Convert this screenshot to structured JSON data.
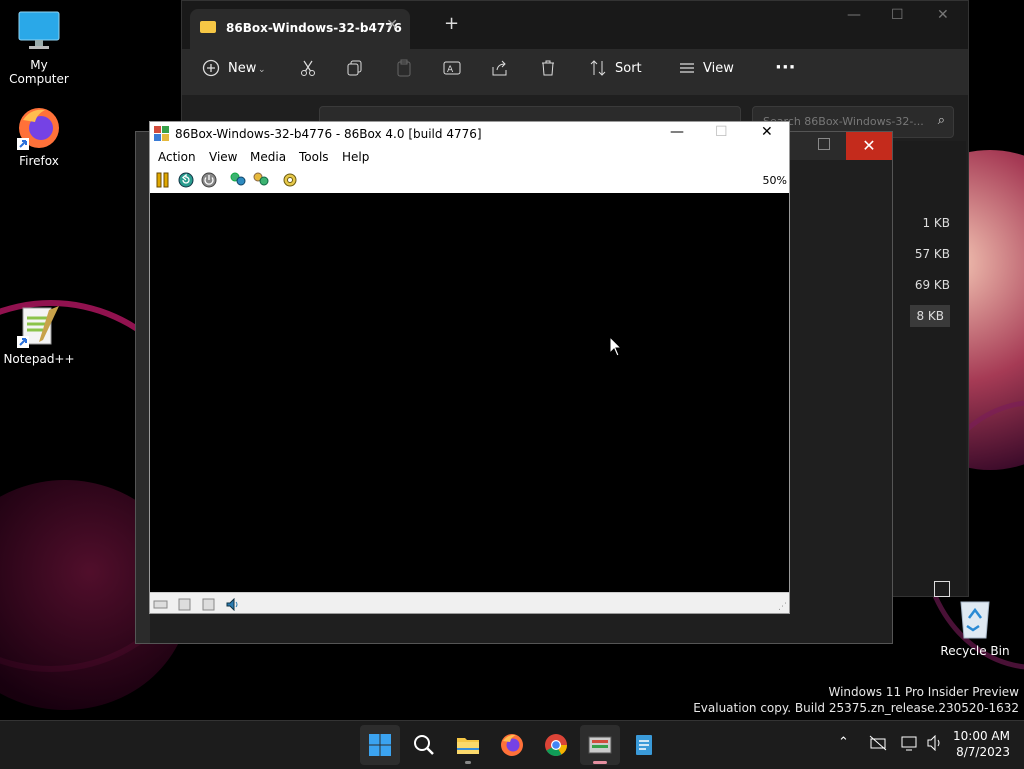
{
  "desktop": {
    "icons": [
      {
        "label": "My Computer"
      },
      {
        "label": "Firefox"
      },
      {
        "label": "Notepad++"
      },
      {
        "label": "Recycle Bin"
      }
    ]
  },
  "explorer": {
    "tab_title": "86Box-Windows-32-b4776",
    "toolbar": {
      "new_label": "New",
      "sort_label": "Sort",
      "view_label": "View"
    },
    "search_placeholder": "Search 86Box-Windows-32-...",
    "sizes": [
      "1 KB",
      "57 KB",
      "69 KB",
      "8 KB"
    ]
  },
  "vm_window": {
    "title": "86Box-Windows-32-b4776 - 86Box 4.0 [build 4776]",
    "menu": [
      "Action",
      "View",
      "Media",
      "Tools",
      "Help"
    ],
    "zoom": "50%"
  },
  "watermark": {
    "line1": "Windows 11 Pro Insider Preview",
    "line2": "Evaluation copy. Build 25375.zn_release.230520-1632"
  },
  "taskbar": {
    "apps": [
      "start",
      "search",
      "file-explorer",
      "firefox",
      "chrome",
      "86box",
      "notepad"
    ],
    "time": "10:00 AM",
    "date": "8/7/2023"
  },
  "colors": {
    "accent": "#0078d4",
    "close_red": "#c42b1c",
    "folder_yellow": "#f6c745"
  }
}
